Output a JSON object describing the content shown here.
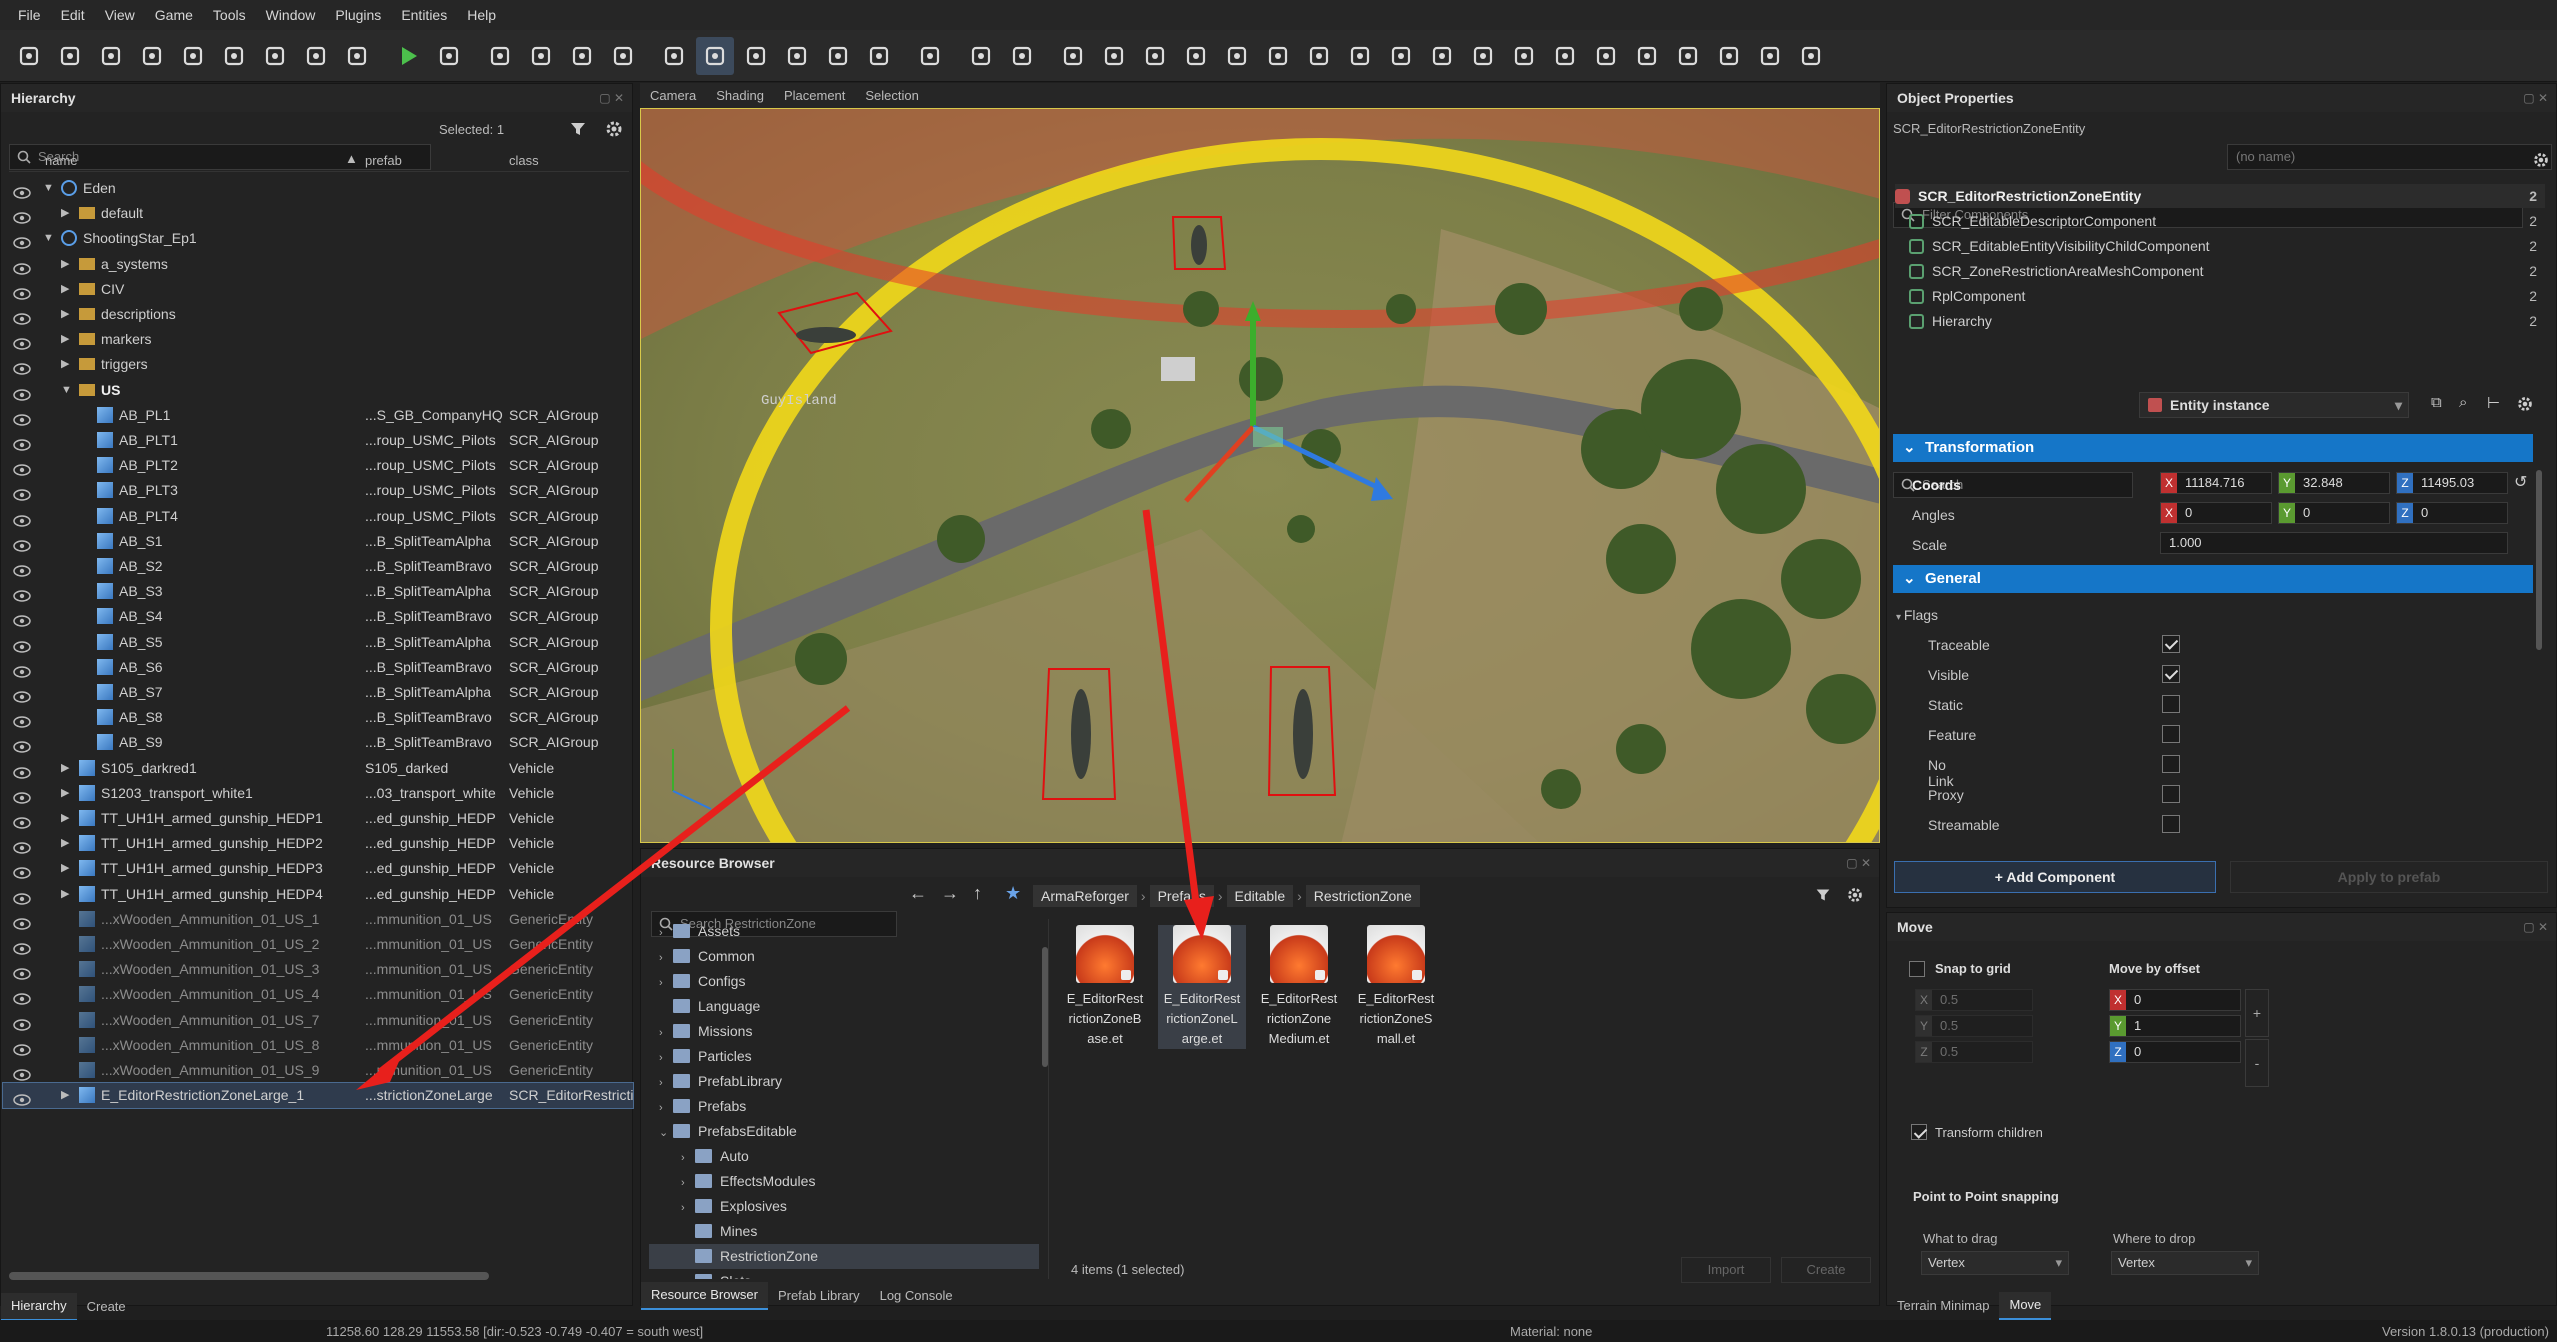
{
  "menu": [
    "File",
    "Edit",
    "View",
    "Game",
    "Tools",
    "Window",
    "Plugins",
    "Entities",
    "Help"
  ],
  "hierarchy": {
    "title": "Hierarchy",
    "search_placeholder": "Search",
    "selected": "Selected: 1",
    "col_name": "name",
    "col_prefab": "prefab",
    "col_class": "class",
    "rows": [
      {
        "name": "Eden",
        "prefab": "",
        "cls": "",
        "indent": 0,
        "exp": "open",
        "icon": "world"
      },
      {
        "name": "default",
        "prefab": "",
        "cls": "",
        "indent": 1,
        "exp": "closed",
        "icon": "folder"
      },
      {
        "name": "ShootingStar_Ep1",
        "prefab": "",
        "cls": "",
        "indent": 0,
        "exp": "open",
        "icon": "world"
      },
      {
        "name": "a_systems",
        "prefab": "",
        "cls": "",
        "indent": 1,
        "exp": "closed",
        "icon": "folder"
      },
      {
        "name": "CIV",
        "prefab": "",
        "cls": "",
        "indent": 1,
        "exp": "closed",
        "icon": "folder"
      },
      {
        "name": "descriptions",
        "prefab": "",
        "cls": "",
        "indent": 1,
        "exp": "closed",
        "icon": "folder"
      },
      {
        "name": "markers",
        "prefab": "",
        "cls": "",
        "indent": 1,
        "exp": "closed",
        "icon": "folder"
      },
      {
        "name": "triggers",
        "prefab": "",
        "cls": "",
        "indent": 1,
        "exp": "closed",
        "icon": "folder"
      },
      {
        "name": "US",
        "prefab": "",
        "cls": "",
        "indent": 1,
        "exp": "open",
        "icon": "folder",
        "bold": true
      },
      {
        "name": "AB_PL1",
        "prefab": "...S_GB_CompanyHQ",
        "cls": "SCR_AIGroup",
        "indent": 2,
        "exp": "",
        "icon": "cube"
      },
      {
        "name": "AB_PLT1",
        "prefab": "...roup_USMC_Pilots",
        "cls": "SCR_AIGroup",
        "indent": 2,
        "exp": "",
        "icon": "cube"
      },
      {
        "name": "AB_PLT2",
        "prefab": "...roup_USMC_Pilots",
        "cls": "SCR_AIGroup",
        "indent": 2,
        "exp": "",
        "icon": "cube"
      },
      {
        "name": "AB_PLT3",
        "prefab": "...roup_USMC_Pilots",
        "cls": "SCR_AIGroup",
        "indent": 2,
        "exp": "",
        "icon": "cube"
      },
      {
        "name": "AB_PLT4",
        "prefab": "...roup_USMC_Pilots",
        "cls": "SCR_AIGroup",
        "indent": 2,
        "exp": "",
        "icon": "cube"
      },
      {
        "name": "AB_S1",
        "prefab": "...B_SplitTeamAlpha",
        "cls": "SCR_AIGroup",
        "indent": 2,
        "exp": "",
        "icon": "cube"
      },
      {
        "name": "AB_S2",
        "prefab": "...B_SplitTeamBravo",
        "cls": "SCR_AIGroup",
        "indent": 2,
        "exp": "",
        "icon": "cube"
      },
      {
        "name": "AB_S3",
        "prefab": "...B_SplitTeamAlpha",
        "cls": "SCR_AIGroup",
        "indent": 2,
        "exp": "",
        "icon": "cube"
      },
      {
        "name": "AB_S4",
        "prefab": "...B_SplitTeamBravo",
        "cls": "SCR_AIGroup",
        "indent": 2,
        "exp": "",
        "icon": "cube"
      },
      {
        "name": "AB_S5",
        "prefab": "...B_SplitTeamAlpha",
        "cls": "SCR_AIGroup",
        "indent": 2,
        "exp": "",
        "icon": "cube"
      },
      {
        "name": "AB_S6",
        "prefab": "...B_SplitTeamBravo",
        "cls": "SCR_AIGroup",
        "indent": 2,
        "exp": "",
        "icon": "cube"
      },
      {
        "name": "AB_S7",
        "prefab": "...B_SplitTeamAlpha",
        "cls": "SCR_AIGroup",
        "indent": 2,
        "exp": "",
        "icon": "cube"
      },
      {
        "name": "AB_S8",
        "prefab": "...B_SplitTeamBravo",
        "cls": "SCR_AIGroup",
        "indent": 2,
        "exp": "",
        "icon": "cube"
      },
      {
        "name": "AB_S9",
        "prefab": "...B_SplitTeamBravo",
        "cls": "SCR_AIGroup",
        "indent": 2,
        "exp": "",
        "icon": "cube"
      },
      {
        "name": "S105_darkred1",
        "prefab": "S105_darked",
        "cls": "Vehicle",
        "indent": 1,
        "exp": "closed",
        "icon": "cube"
      },
      {
        "name": "S1203_transport_white1",
        "prefab": "...03_transport_white",
        "cls": "Vehicle",
        "indent": 1,
        "exp": "closed",
        "icon": "cube"
      },
      {
        "name": "TT_UH1H_armed_gunship_HEDP1",
        "prefab": "...ed_gunship_HEDP",
        "cls": "Vehicle",
        "indent": 1,
        "exp": "closed",
        "icon": "cube"
      },
      {
        "name": "TT_UH1H_armed_gunship_HEDP2",
        "prefab": "...ed_gunship_HEDP",
        "cls": "Vehicle",
        "indent": 1,
        "exp": "closed",
        "icon": "cube"
      },
      {
        "name": "TT_UH1H_armed_gunship_HEDP3",
        "prefab": "...ed_gunship_HEDP",
        "cls": "Vehicle",
        "indent": 1,
        "exp": "closed",
        "icon": "cube"
      },
      {
        "name": "TT_UH1H_armed_gunship_HEDP4",
        "prefab": "...ed_gunship_HEDP",
        "cls": "Vehicle",
        "indent": 1,
        "exp": "closed",
        "icon": "cube"
      },
      {
        "name": "...xWooden_Ammunition_01_US_1",
        "prefab": "...mmunition_01_US",
        "cls": "GenericEntity",
        "indent": 1,
        "exp": "",
        "icon": "cube",
        "dim": true
      },
      {
        "name": "...xWooden_Ammunition_01_US_2",
        "prefab": "...mmunition_01_US",
        "cls": "GenericEntity",
        "indent": 1,
        "exp": "",
        "icon": "cube",
        "dim": true
      },
      {
        "name": "...xWooden_Ammunition_01_US_3",
        "prefab": "...mmunition_01_US",
        "cls": "GenericEntity",
        "indent": 1,
        "exp": "",
        "icon": "cube",
        "dim": true
      },
      {
        "name": "...xWooden_Ammunition_01_US_4",
        "prefab": "...mmunition_01_US",
        "cls": "GenericEntity",
        "indent": 1,
        "exp": "",
        "icon": "cube",
        "dim": true
      },
      {
        "name": "...xWooden_Ammunition_01_US_7",
        "prefab": "...mmunition_01_US",
        "cls": "GenericEntity",
        "indent": 1,
        "exp": "",
        "icon": "cube",
        "dim": true
      },
      {
        "name": "...xWooden_Ammunition_01_US_8",
        "prefab": "...mmunition_01_US",
        "cls": "GenericEntity",
        "indent": 1,
        "exp": "",
        "icon": "cube",
        "dim": true
      },
      {
        "name": "...xWooden_Ammunition_01_US_9",
        "prefab": "...mmunition_01_US",
        "cls": "GenericEntity",
        "indent": 1,
        "exp": "",
        "icon": "cube",
        "dim": true
      },
      {
        "name": "E_EditorRestrictionZoneLarge_1",
        "prefab": "...strictionZoneLarge",
        "cls": "SCR_EditorRestricti",
        "indent": 1,
        "exp": "closed",
        "icon": "cube",
        "sel": true
      }
    ],
    "bottom_tabs": [
      "Hierarchy",
      "Create"
    ]
  },
  "viewport": {
    "tabs": [
      "Camera",
      "Shading",
      "Placement",
      "Selection"
    ],
    "label": "GuyIsland"
  },
  "resource": {
    "title": "Resource Browser",
    "search_placeholder": "Search RestrictionZone",
    "breadcrumb": [
      "ArmaReforger",
      "Prefabs",
      "Editable",
      "RestrictionZone"
    ],
    "tree": [
      {
        "label": "Assets",
        "indent": 0
      },
      {
        "label": "Common",
        "indent": 0
      },
      {
        "label": "Configs",
        "indent": 0
      },
      {
        "label": "Language",
        "indent": 0,
        "noexp": true
      },
      {
        "label": "Missions",
        "indent": 0
      },
      {
        "label": "Particles",
        "indent": 0
      },
      {
        "label": "PrefabLibrary",
        "indent": 0
      },
      {
        "label": "Prefabs",
        "indent": 0
      },
      {
        "label": "PrefabsEditable",
        "indent": 0,
        "open": true
      },
      {
        "label": "Auto",
        "indent": 1
      },
      {
        "label": "EffectsModules",
        "indent": 1
      },
      {
        "label": "Explosives",
        "indent": 1
      },
      {
        "label": "Mines",
        "indent": 1,
        "noexp": true
      },
      {
        "label": "RestrictionZone",
        "indent": 1,
        "noexp": true,
        "sel": true
      },
      {
        "label": "Slots",
        "indent": 1
      }
    ],
    "files": [
      {
        "lines": [
          "E_EditorRest",
          "rictionZoneB",
          "ase.et"
        ]
      },
      {
        "lines": [
          "E_EditorRest",
          "rictionZoneL",
          "arge.et"
        ],
        "sel": true
      },
      {
        "lines": [
          "E_EditorRest",
          "rictionZone",
          "Medium.et"
        ]
      },
      {
        "lines": [
          "E_EditorRest",
          "rictionZoneS",
          "mall.et"
        ]
      }
    ],
    "count": "4 items (1 selected)",
    "import": "Import",
    "create": "Create",
    "bottom_tabs": [
      "Resource Browser",
      "Prefab Library",
      "Log Console"
    ]
  },
  "props": {
    "title": "Object Properties",
    "entity_class": "SCR_EditorRestrictionZoneEntity",
    "entity_name": "(no name)",
    "filter_placeholder": "Filter Components",
    "components": [
      {
        "label": "SCR_EditorRestrictionZoneEntity",
        "count": "2",
        "root": true
      },
      {
        "label": "SCR_EditableDescriptorComponent",
        "count": "2"
      },
      {
        "label": "SCR_EditableEntityVisibilityChildComponent",
        "count": "2"
      },
      {
        "label": "SCR_ZoneRestrictionAreaMeshComponent",
        "count": "2"
      },
      {
        "label": "RplComponent",
        "count": "2"
      },
      {
        "label": "Hierarchy",
        "count": "2"
      }
    ],
    "search_placeholder": "Search",
    "instance": "Entity instance",
    "transformation": "Transformation",
    "coords_label": "Coords",
    "coords": {
      "x": "11184.716",
      "y": "32.848",
      "z": "11495.03"
    },
    "angles_label": "Angles",
    "angles": {
      "x": "0",
      "y": "0",
      "z": "0"
    },
    "scale_label": "Scale",
    "scale": "1.000",
    "general": "General",
    "flags": "Flags",
    "flag_items": [
      {
        "label": "Traceable",
        "on": true
      },
      {
        "label": "Visible",
        "on": true
      },
      {
        "label": "Static",
        "on": false
      },
      {
        "label": "Feature",
        "on": false
      },
      {
        "label": "No Link",
        "on": false
      },
      {
        "label": "Proxy",
        "on": false
      },
      {
        "label": "Streamable",
        "on": false
      }
    ],
    "add_component": "+ Add Component",
    "apply_prefab": "Apply to prefab"
  },
  "move": {
    "title": "Move",
    "snap": "Snap to grid",
    "snap_vals": [
      "0.5",
      "0.5",
      "0.5"
    ],
    "offset": "Move by offset",
    "offset_vals": [
      "0",
      "1",
      "0"
    ],
    "transform_children": "Transform children",
    "p2p": "Point to Point snapping",
    "what": "What to drag",
    "where": "Where to drop",
    "what_val": "Vertex",
    "where_val": "Vertex",
    "bottom_tabs": [
      "Terrain Minimap",
      "Move"
    ]
  },
  "status": {
    "coords": "11258.60    128.29  11553.58 [dir:-0.523 -0.749 -0.407 = south west]",
    "material": "Material: none",
    "version": "Version 1.8.0.13 (production)"
  },
  "colors": {
    "accent": "#1576c8",
    "arrow": "#e8201c",
    "zone": "#f2d81a"
  }
}
